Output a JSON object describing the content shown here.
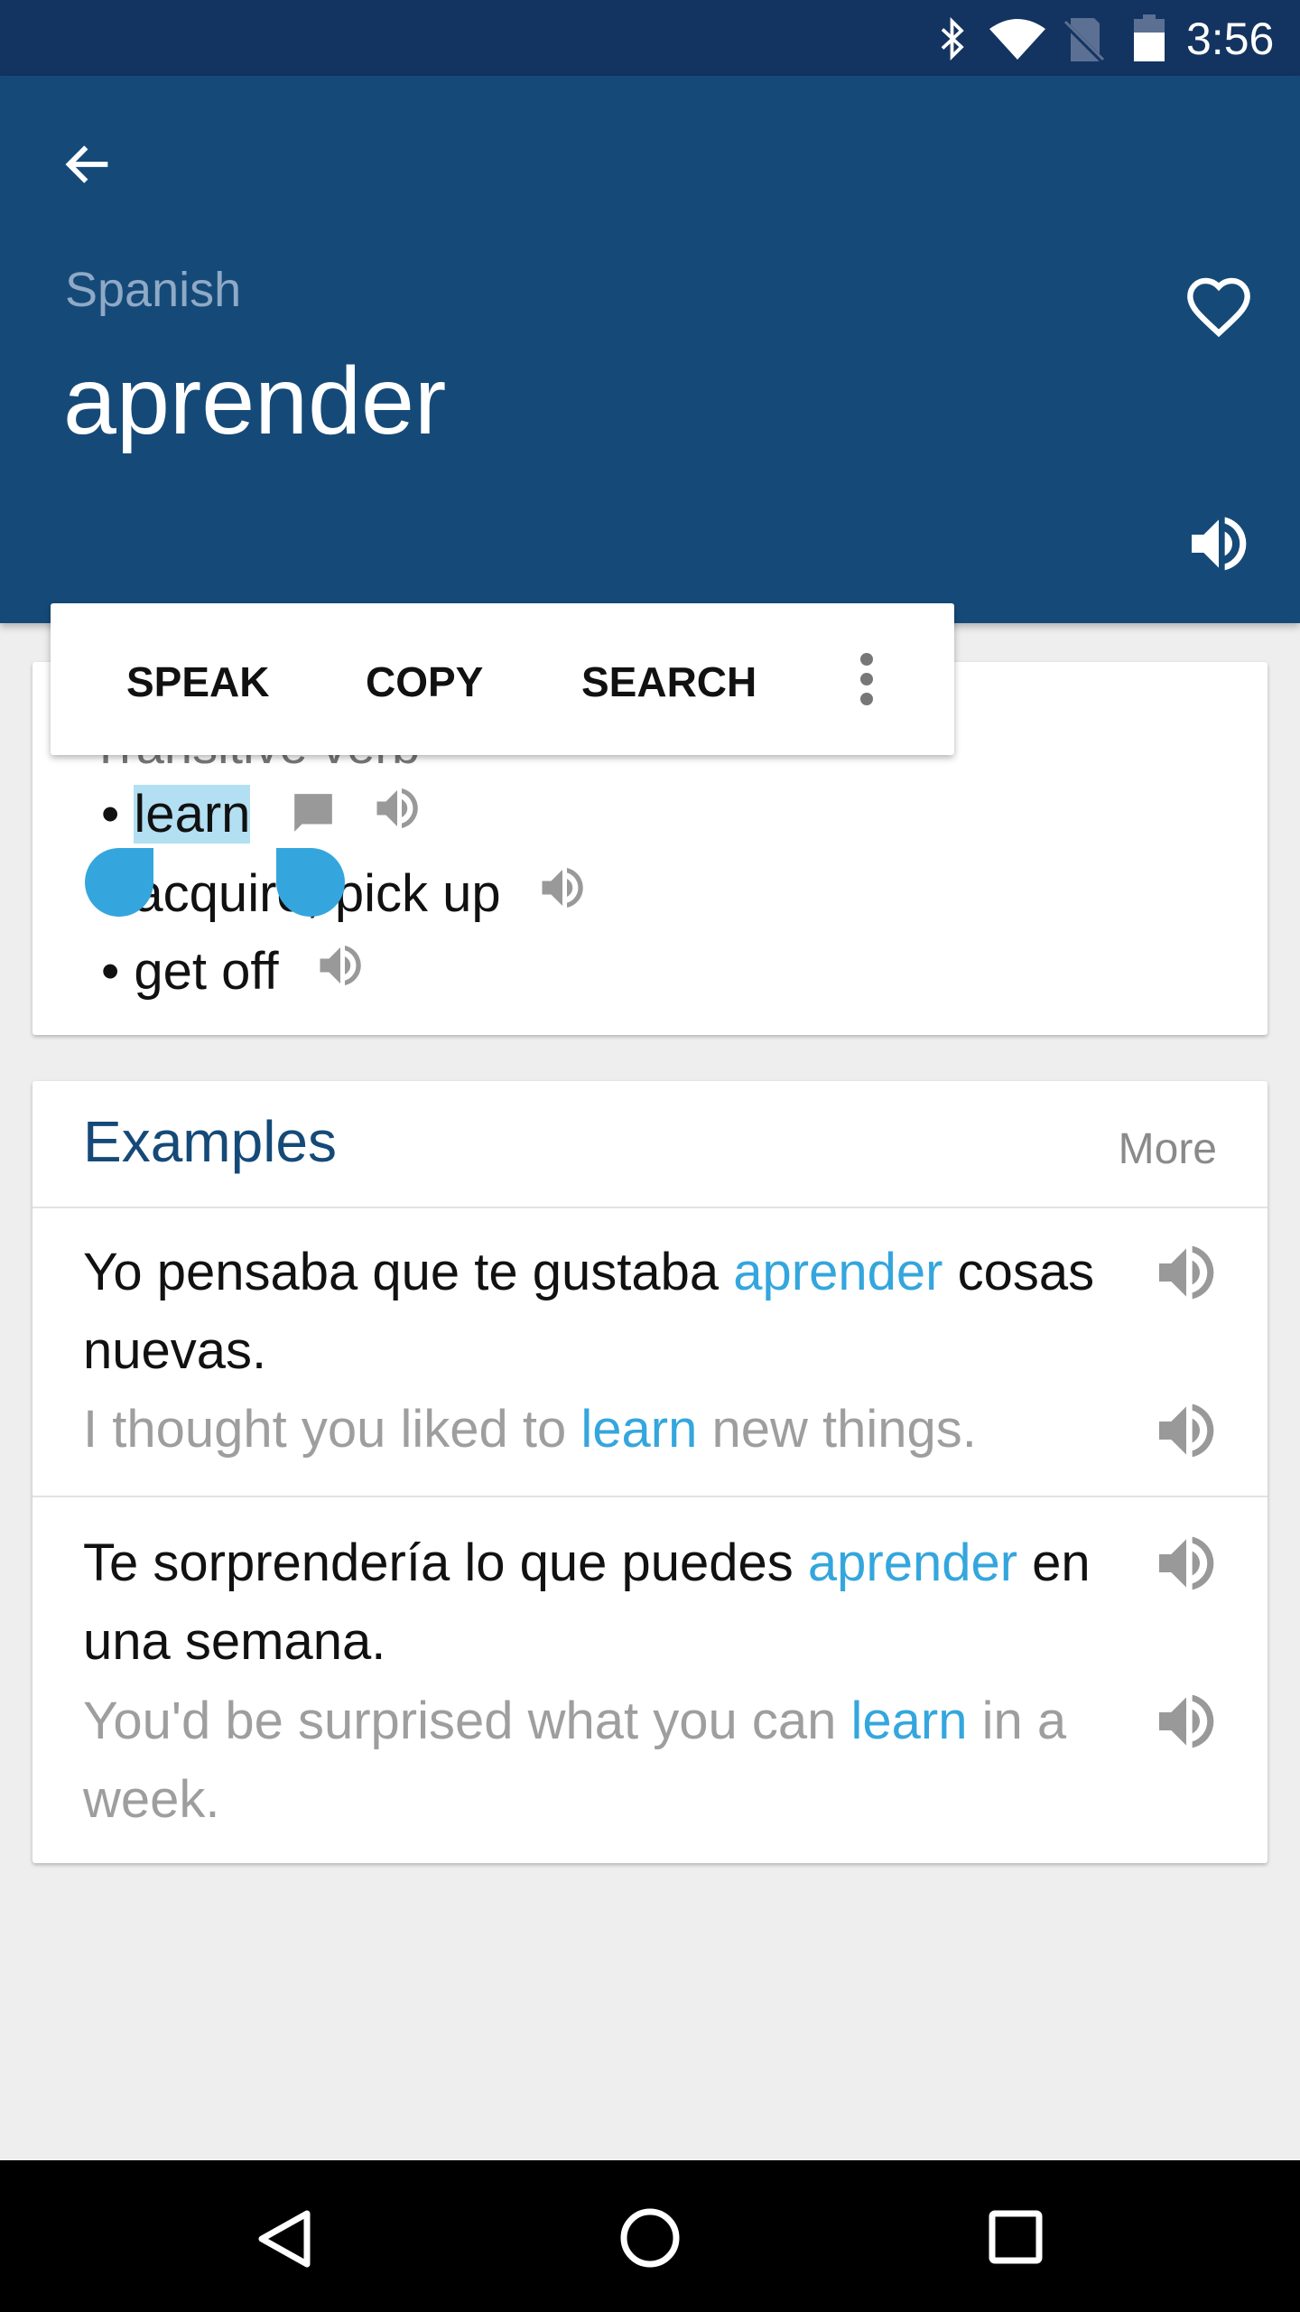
{
  "status_bar": {
    "time": "3:56",
    "icons": [
      "bluetooth-icon",
      "wifi-icon",
      "no-sim-icon",
      "battery-icon"
    ]
  },
  "header": {
    "language": "Spanish",
    "word": "aprender",
    "back_icon": "arrow-left-icon",
    "favorite_icon": "heart-outline-icon",
    "speak_icon": "volume-icon"
  },
  "selection_popup": {
    "items": [
      "SPEAK",
      "COPY",
      "SEARCH"
    ],
    "more_icon": "more-vert-icon"
  },
  "definitions": {
    "heading": "Transitive verb",
    "items": [
      {
        "text": "learn",
        "selected": true
      },
      {
        "text": "acquire, pick up"
      },
      {
        "text": "get off"
      }
    ]
  },
  "examples": {
    "title": "Examples",
    "more": "More",
    "items": [
      {
        "es_before": "Yo pensaba que te gustaba ",
        "es_hl": "aprender",
        "es_after": " cosas nuevas.",
        "en_before": "I thought you liked to ",
        "en_hl": "learn",
        "en_after": " new things."
      },
      {
        "es_before": "Te sorprendería lo que puedes ",
        "es_hl": "aprender",
        "es_after": " en una semana.",
        "en_before": "You'd be surprised what you can ",
        "en_hl": "learn",
        "en_after": " in a week."
      }
    ]
  },
  "colors": {
    "primary": "#154a78",
    "status": "#133461",
    "accent": "#34a6dd",
    "selection": "#b3dff2"
  }
}
